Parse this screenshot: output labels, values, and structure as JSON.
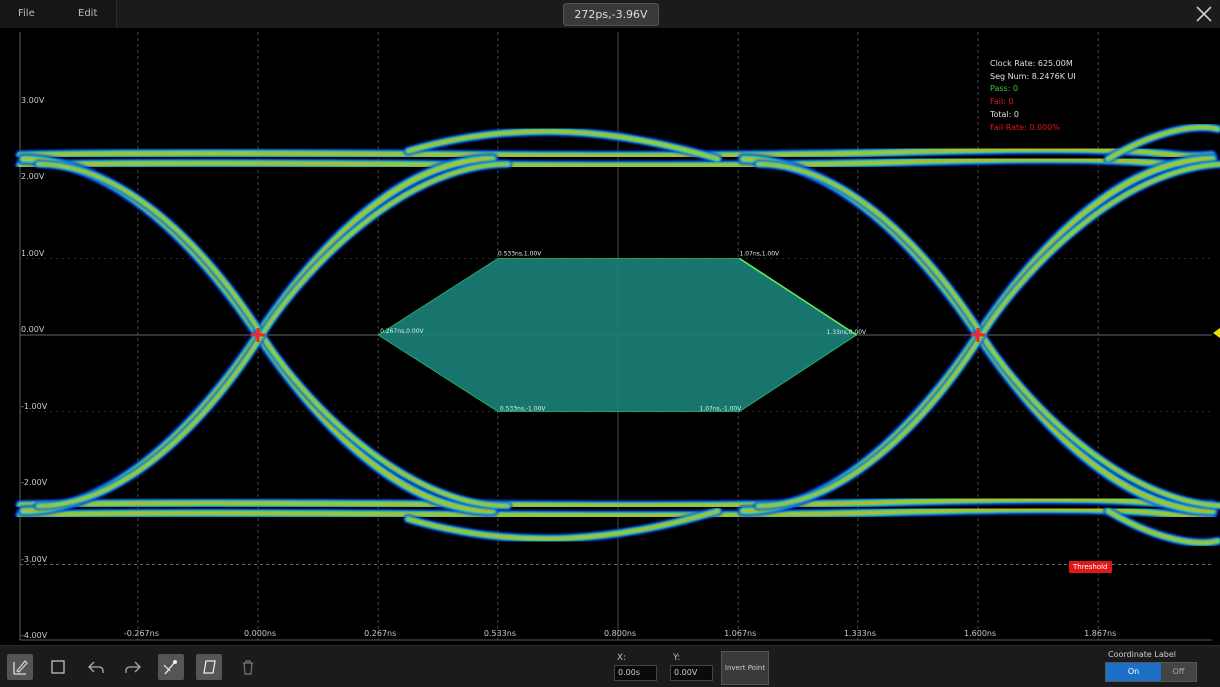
{
  "menu": {
    "file": "File",
    "edit": "Edit"
  },
  "cursor_readout": "272ps,-3.96V",
  "y_ticks": [
    {
      "label": "3.00V",
      "volts": 3
    },
    {
      "label": "2.00V",
      "volts": 2
    },
    {
      "label": "1.00V",
      "volts": 1
    },
    {
      "label": "0.00V",
      "volts": 0
    },
    {
      "label": "-1.00V",
      "volts": -1
    },
    {
      "label": "-2.00V",
      "volts": -2
    },
    {
      "label": "-3.00V",
      "volts": -3
    },
    {
      "label": "-4.00V",
      "volts": -4
    }
  ],
  "x_ticks": [
    {
      "label": "-0.267ns",
      "ns": -0.267
    },
    {
      "label": "0.000ns",
      "ns": 0.0
    },
    {
      "label": "0.267ns",
      "ns": 0.267
    },
    {
      "label": "0.533ns",
      "ns": 0.533
    },
    {
      "label": "0.800ns",
      "ns": 0.8
    },
    {
      "label": "1.067ns",
      "ns": 1.067
    },
    {
      "label": "1.333ns",
      "ns": 1.333
    },
    {
      "label": "1.600ns",
      "ns": 1.6
    },
    {
      "label": "1.867ns",
      "ns": 1.867
    }
  ],
  "stats": {
    "clock_rate": "Clock Rate: 625.00M",
    "seg_num": "Seg Num: 8.2476K UI",
    "pass": "Pass: 0",
    "fail": "Fail: 0",
    "total": "Total: 0",
    "fail_rate": "Fail Rate: 0.000%"
  },
  "mask": {
    "points": [
      {
        "label": "0.267ns,0.00V",
        "ns": 0.267,
        "v": 0.0
      },
      {
        "label": "0.533ns,1.00V",
        "ns": 0.533,
        "v": 1.0
      },
      {
        "label": "1.07ns,1.00V",
        "ns": 1.07,
        "v": 1.0
      },
      {
        "label": "1.33ns,0.00V",
        "ns": 1.33,
        "v": 0.0
      },
      {
        "label": "1.07ns,-1.00V",
        "ns": 1.07,
        "v": -1.0
      },
      {
        "label": "0.533ns,-1.00V",
        "ns": 0.533,
        "v": -1.0
      }
    ],
    "fill_color": "#1a7f78",
    "edge_color": "#2fd07a"
  },
  "marker_tag": "Threshold",
  "bottom": {
    "x_label": "X:",
    "x_value": "0.00s",
    "y_label": "Y:",
    "y_value": "0.00V",
    "invert_button": "Invert Point",
    "coordinate_label_title": "Coordinate Label",
    "toggle_on": "On",
    "toggle_off": "Off"
  },
  "colors": {
    "accent": "#1e6fc8",
    "fail_red": "#e01818",
    "pass_green": "#33cc33",
    "trace_yellow": "#e8e000"
  },
  "tools": [
    {
      "name": "draw-pen-icon",
      "active": true
    },
    {
      "name": "rectangle-select-icon",
      "active": false
    },
    {
      "name": "undo-icon",
      "active": false
    },
    {
      "name": "redo-icon",
      "active": false
    },
    {
      "name": "point-edit-icon",
      "active": true
    },
    {
      "name": "polygon-mask-icon",
      "active": true
    },
    {
      "name": "delete-icon",
      "active": false
    }
  ]
}
